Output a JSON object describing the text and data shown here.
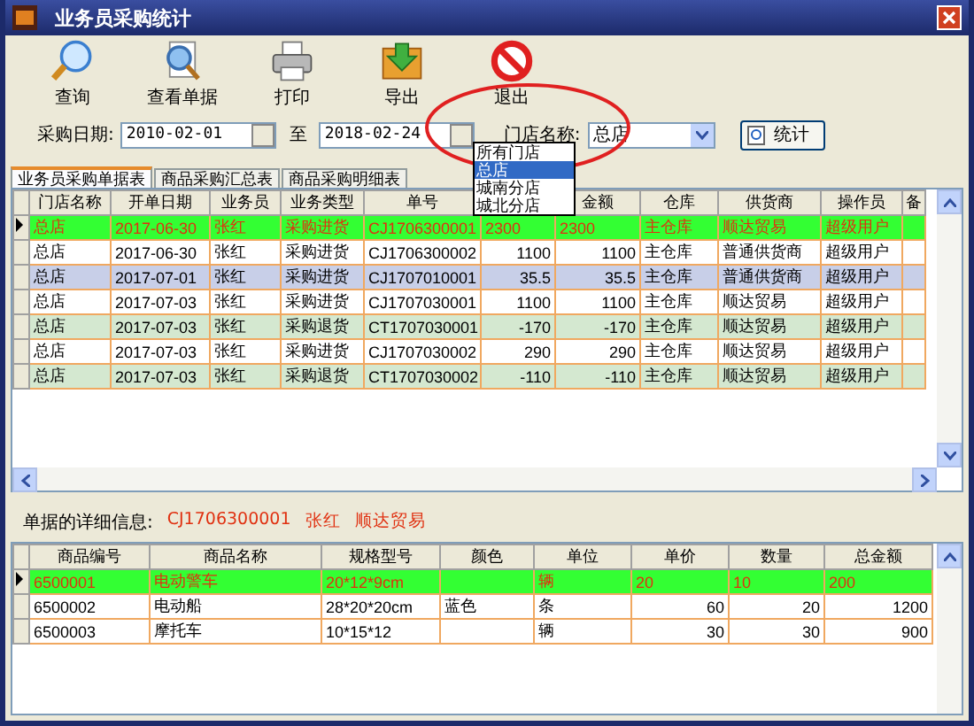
{
  "window": {
    "title": "业务员采购统计"
  },
  "toolbar": [
    {
      "kind": "search",
      "label": "查询"
    },
    {
      "kind": "view",
      "label": "查看单据"
    },
    {
      "kind": "print",
      "label": "打印"
    },
    {
      "kind": "export",
      "label": "导出"
    },
    {
      "kind": "exit",
      "label": "退出"
    }
  ],
  "filter": {
    "date_label": "采购日期:",
    "date_from": "2010-02-01",
    "to_label": "至",
    "date_to": "2018-02-24",
    "store_label": "门店名称:",
    "store_value": "总店",
    "stats_button": "统计"
  },
  "store_dropdown": {
    "options": [
      {
        "label": "所有门店",
        "selected": false
      },
      {
        "label": "总店",
        "selected": true
      },
      {
        "label": "城南分店",
        "selected": false
      },
      {
        "label": "城北分店",
        "selected": false
      }
    ]
  },
  "annotation": {
    "kind": "ellipse"
  },
  "tabs": [
    {
      "label": "业务员采购单据表",
      "selected": true
    },
    {
      "label": "商品采购汇总表",
      "selected": false
    },
    {
      "label": "商品采购明细表",
      "selected": false
    }
  ],
  "orders": {
    "columns": [
      {
        "label": "门店名称",
        "kind": "text"
      },
      {
        "label": "开单日期",
        "kind": "text"
      },
      {
        "label": "业务员",
        "kind": "text"
      },
      {
        "label": "业务类型",
        "kind": "text"
      },
      {
        "label": "单号",
        "kind": "text"
      },
      {
        "kind": "number"
      },
      {
        "label": "金额",
        "kind": "number"
      },
      {
        "label": "仓库",
        "kind": "text"
      },
      {
        "label": "供货商",
        "kind": "text"
      },
      {
        "label": "操作员",
        "kind": "text"
      },
      {
        "label": "备",
        "kind": "text"
      }
    ],
    "rows": [
      {
        "selected": true,
        "color": "#33ff33",
        "cells": [
          "总店",
          "2017-06-30",
          "张红",
          "采购进货",
          "CJ1706300001",
          "2300",
          "2300",
          "主仓库",
          "顺达贸易",
          "超级用户",
          ""
        ]
      },
      {
        "selected": false,
        "color": "#ffffff",
        "cells": [
          "总店",
          "2017-06-30",
          "张红",
          "采购进货",
          "CJ1706300002",
          "1100",
          "1100",
          "主仓库",
          "普通供货商",
          "超级用户",
          ""
        ]
      },
      {
        "selected": false,
        "color": "#c8cfe8",
        "cells": [
          "总店",
          "2017-07-01",
          "张红",
          "采购进货",
          "CJ1707010001",
          "35.5",
          "35.5",
          "主仓库",
          "普通供货商",
          "超级用户",
          ""
        ]
      },
      {
        "selected": false,
        "color": "#ffffff",
        "cells": [
          "总店",
          "2017-07-03",
          "张红",
          "采购进货",
          "CJ1707030001",
          "1100",
          "1100",
          "主仓库",
          "顺达贸易",
          "超级用户",
          ""
        ]
      },
      {
        "selected": false,
        "color": "#d4e8d0",
        "cells": [
          "总店",
          "2017-07-03",
          "张红",
          "采购退货",
          "CT1707030001",
          "-170",
          "-170",
          "主仓库",
          "顺达贸易",
          "超级用户",
          ""
        ]
      },
      {
        "selected": false,
        "color": "#ffffff",
        "cells": [
          "总店",
          "2017-07-03",
          "张红",
          "采购进货",
          "CJ1707030002",
          "290",
          "290",
          "主仓库",
          "顺达贸易",
          "超级用户",
          ""
        ]
      },
      {
        "selected": false,
        "color": "#d4e8d0",
        "cells": [
          "总店",
          "2017-07-03",
          "张红",
          "采购退货",
          "CT1707030002",
          "-110",
          "-110",
          "主仓库",
          "顺达贸易",
          "超级用户",
          ""
        ]
      }
    ]
  },
  "detail": {
    "label": "单据的详细信息:",
    "order_no": "CJ1706300001",
    "salesperson": "张红",
    "supplier": "顺达贸易"
  },
  "items": {
    "columns": [
      {
        "label": "商品编号",
        "kind": "text"
      },
      {
        "label": "商品名称",
        "kind": "text"
      },
      {
        "label": "规格型号",
        "kind": "text"
      },
      {
        "label": "颜色",
        "kind": "text"
      },
      {
        "label": "单位",
        "kind": "text"
      },
      {
        "label": "单价",
        "kind": "number"
      },
      {
        "label": "数量",
        "kind": "number"
      },
      {
        "label": "总金额",
        "kind": "number"
      }
    ],
    "rows": [
      {
        "selected": true,
        "cells": [
          "6500001",
          "电动警车",
          "20*12*9cm",
          "",
          "辆",
          "20",
          "10",
          "200"
        ]
      },
      {
        "selected": false,
        "cells": [
          "6500002",
          "电动船",
          "28*20*20cm",
          "蓝色",
          "条",
          "60",
          "20",
          "1200"
        ]
      },
      {
        "selected": false,
        "cells": [
          "6500003",
          "摩托车",
          "10*15*12",
          "",
          "辆",
          "30",
          "30",
          "900"
        ]
      }
    ]
  }
}
